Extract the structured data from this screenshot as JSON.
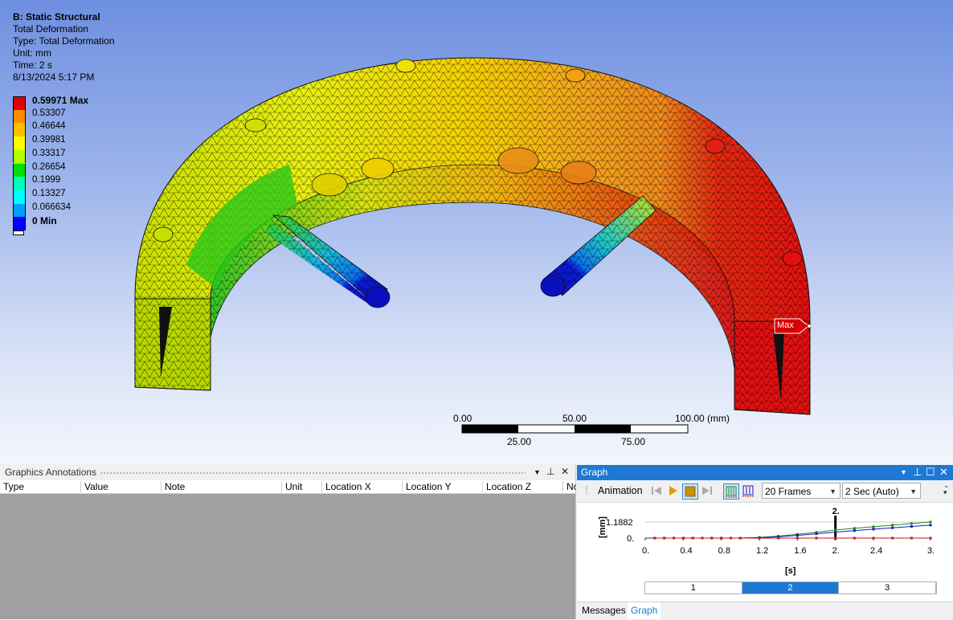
{
  "viewport": {
    "analysis_title": "B: Static Structural",
    "result_name": "Total Deformation",
    "result_type": "Type: Total Deformation",
    "unit": "Unit: mm",
    "time": "Time: 2 s",
    "timestamp": "8/13/2024 5:17 PM",
    "max_tag": "Max"
  },
  "legend": {
    "entries": [
      {
        "label": "0.59971 Max",
        "color": "#e00000",
        "bold": true
      },
      {
        "label": "0.53307",
        "color": "#ff8c00"
      },
      {
        "label": "0.46644",
        "color": "#ffc000"
      },
      {
        "label": "0.39981",
        "color": "#ffff00"
      },
      {
        "label": "0.33317",
        "color": "#b4ff00"
      },
      {
        "label": "0.26654",
        "color": "#00e000"
      },
      {
        "label": "0.1999",
        "color": "#00ffb4"
      },
      {
        "label": "0.13327",
        "color": "#00ffff"
      },
      {
        "label": "0.066634",
        "color": "#00a0ff"
      },
      {
        "label": "0 Min",
        "color": "#0000ff",
        "bold": true
      }
    ]
  },
  "scale_bar": {
    "top_labels": [
      "0.00",
      "50.00",
      "100.00 (mm)"
    ],
    "bottom_labels": [
      "25.00",
      "75.00"
    ]
  },
  "annotations_panel": {
    "title": "Graphics Annotations",
    "columns": [
      "Type",
      "Value",
      "Note",
      "Unit",
      "Location X",
      "Location Y",
      "Location Z",
      "No"
    ]
  },
  "graph_panel": {
    "title": "Graph",
    "animation_label": "Animation",
    "frames_combo": "20 Frames",
    "duration_combo": "2 Sec (Auto)",
    "y_axis_unit": "[mm]",
    "y_tick_top": "1.1882",
    "y_tick_zero": "0.",
    "x_ticks": [
      "0.",
      "0.4",
      "0.8",
      "1.2",
      "1.6",
      "2.",
      "2.4",
      "3."
    ],
    "x_axis_unit": "[s]",
    "current_time_label": "2.",
    "frames": [
      "1",
      "2",
      "3"
    ],
    "selected_frame": "2",
    "tabs": [
      "Messages",
      "Graph"
    ],
    "active_tab": "Graph",
    "accent": "#1e78d4"
  },
  "chart_data": {
    "type": "line",
    "xlabel": "[s]",
    "ylabel": "[mm]",
    "xlim": [
      0,
      3
    ],
    "ylim": [
      0,
      1.1882
    ],
    "x": [
      0.1,
      0.2,
      0.3,
      0.4,
      0.5,
      0.6,
      0.7,
      0.8,
      0.9,
      1.0,
      1.2,
      1.4,
      1.6,
      1.8,
      2.0,
      2.2,
      2.4,
      2.6,
      2.8,
      3.0
    ],
    "series": [
      {
        "color": "#1a8c1a",
        "values": [
          0,
          0,
          0,
          0,
          0,
          0,
          0,
          0,
          0,
          0,
          0.05,
          0.14,
          0.28,
          0.42,
          0.6,
          0.72,
          0.84,
          0.96,
          1.08,
          1.19
        ]
      },
      {
        "color": "#1a1ac0",
        "values": [
          0,
          0,
          0,
          0,
          0,
          0,
          0,
          0,
          0,
          0,
          0.03,
          0.1,
          0.2,
          0.32,
          0.44,
          0.55,
          0.66,
          0.76,
          0.86,
          0.96
        ]
      },
      {
        "color": "#c01a1a",
        "values": [
          0,
          0,
          0,
          0,
          0,
          0,
          0,
          0,
          0,
          0,
          0,
          0,
          0,
          0,
          0,
          0,
          0,
          0,
          0,
          0
        ]
      }
    ]
  }
}
